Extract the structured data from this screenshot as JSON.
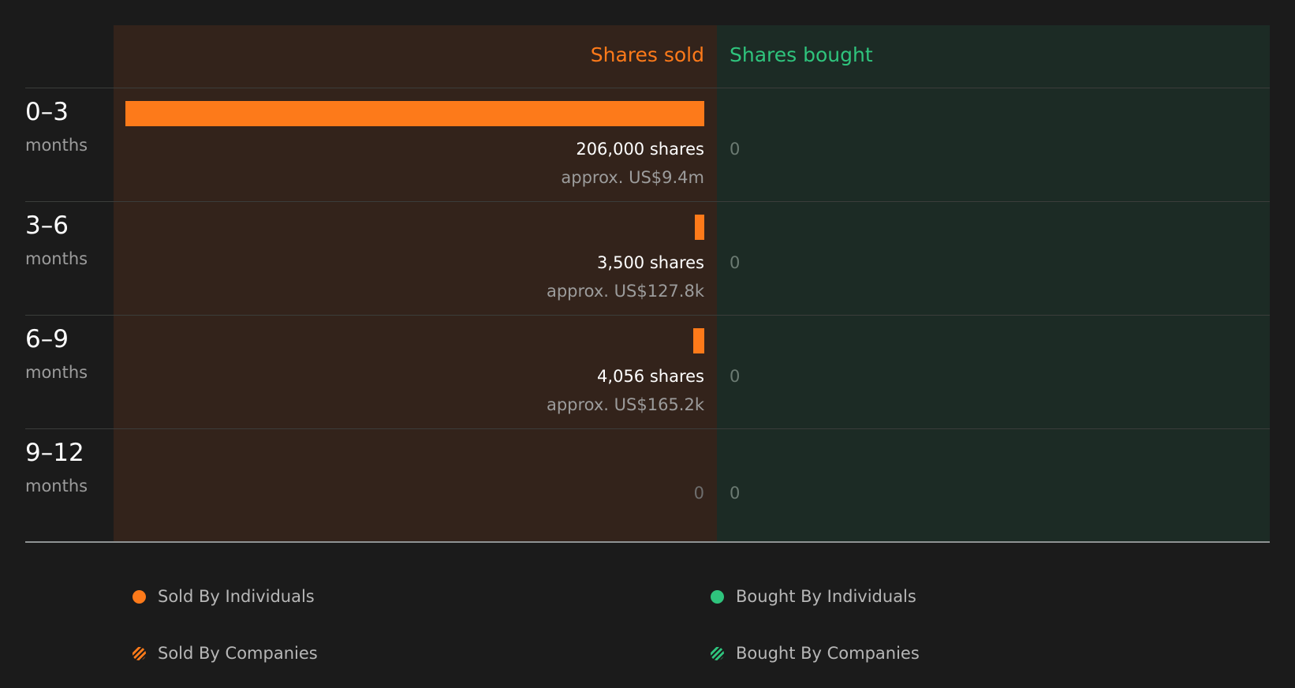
{
  "chart_data": {
    "type": "bar",
    "columns": {
      "sold_label": "Shares sold",
      "bought_label": "Shares bought"
    },
    "categories": [
      {
        "period": "0–3",
        "unit": "months"
      },
      {
        "period": "3–6",
        "unit": "months"
      },
      {
        "period": "6–9",
        "unit": "months"
      },
      {
        "period": "9–12",
        "unit": "months"
      }
    ],
    "series": [
      {
        "name": "Shares sold",
        "values": [
          206000,
          3500,
          4056,
          0
        ],
        "value_labels": [
          "206,000 shares",
          "3,500 shares",
          "4,056 shares",
          "0"
        ],
        "approx_labels": [
          "approx. US$9.4m",
          "approx. US$127.8k",
          "approx. US$165.2k",
          ""
        ]
      },
      {
        "name": "Shares bought",
        "values": [
          0,
          0,
          0,
          0
        ],
        "value_labels": [
          "0",
          "0",
          "0",
          "0"
        ]
      }
    ],
    "legend": [
      {
        "label": "Sold By Individuals",
        "color": "#fd7a1a",
        "style": "solid"
      },
      {
        "label": "Bought By Individuals",
        "color": "#2fc47d",
        "style": "solid"
      },
      {
        "label": "Sold By Companies",
        "color": "#fd7a1a",
        "style": "hatched"
      },
      {
        "label": "Bought By Companies",
        "color": "#2fc47d",
        "style": "hatched"
      }
    ],
    "colors": {
      "sold": "#fd7a1a",
      "bought": "#2fc47d",
      "sold_background": "#33231b",
      "bought_background": "#1c2b25"
    }
  }
}
